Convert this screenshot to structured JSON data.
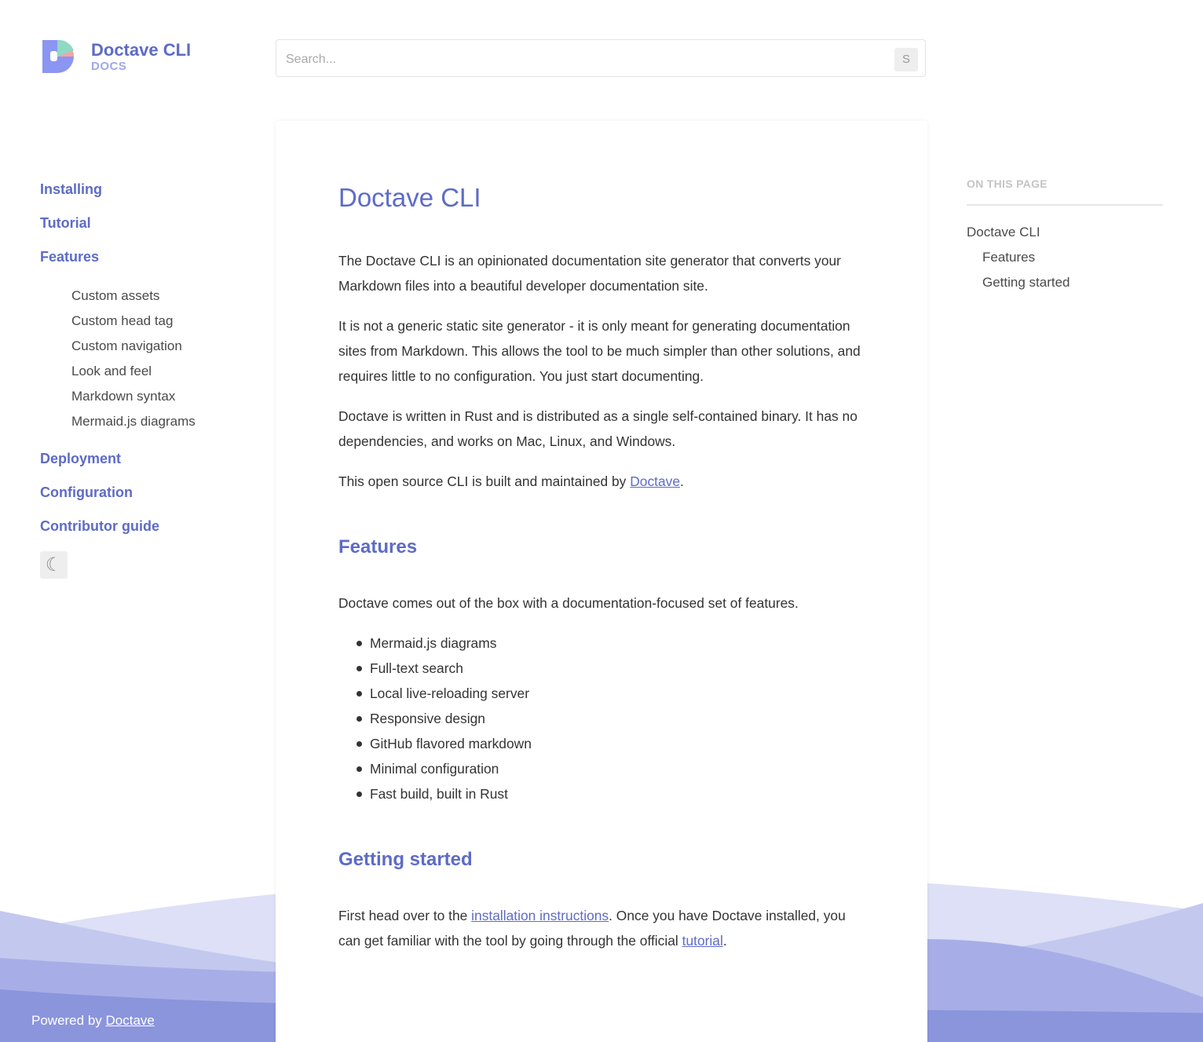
{
  "brand": {
    "title": "Doctave CLI",
    "subtitle": "DOCS"
  },
  "search": {
    "placeholder": "Search...",
    "shortcut": "S"
  },
  "sidebar": {
    "items": [
      {
        "label": "Installing"
      },
      {
        "label": "Tutorial"
      },
      {
        "label": "Features",
        "children": [
          "Custom assets",
          "Custom head tag",
          "Custom navigation",
          "Look and feel",
          "Markdown syntax",
          "Mermaid.js diagrams"
        ]
      },
      {
        "label": "Deployment"
      },
      {
        "label": "Configuration"
      },
      {
        "label": "Contributor guide"
      }
    ],
    "theme_toggle_icon": "moon-icon",
    "theme_toggle_glyph": "☾"
  },
  "content": {
    "title": "Doctave CLI",
    "intro": [
      "The Doctave CLI is an opinionated documentation site generator that converts your Markdown files into a beautiful developer documentation site.",
      "It is not a generic static site generator - it is only meant for generating documentation sites from Markdown. This allows the tool to be much simpler than other solutions, and requires little to no configuration. You just start documenting.",
      "Doctave is written in Rust and is distributed as a single self-contained binary. It has no dependencies, and works on Mac, Linux, and Windows."
    ],
    "maintained": {
      "before": "This open source CLI is built and maintained by ",
      "link": "Doctave",
      "after": "."
    },
    "features_heading": "Features",
    "features_intro": "Doctave comes out of the box with a documentation-focused set of features.",
    "features": [
      "Mermaid.js diagrams",
      "Full-text search",
      "Local live-reloading server",
      "Responsive design",
      "GitHub flavored markdown",
      "Minimal configuration",
      "Fast build, built in Rust"
    ],
    "getting_started_heading": "Getting started",
    "getting_started": {
      "before": "First head over to the ",
      "link1": "installation instructions",
      "middle": ". Once you have Doctave installed, you can get familiar with the tool by going through the official ",
      "link2": "tutorial",
      "after": "."
    }
  },
  "toc": {
    "title": "ON THIS PAGE",
    "items": [
      {
        "label": "Doctave CLI"
      },
      {
        "label": "Features"
      },
      {
        "label": "Getting started"
      }
    ]
  },
  "footer": {
    "prefix": "Powered by ",
    "link": "Doctave"
  },
  "colors": {
    "accent": "#5d6bc7",
    "accent_light": "#a0a8e6",
    "wave": "#8b95dc"
  }
}
